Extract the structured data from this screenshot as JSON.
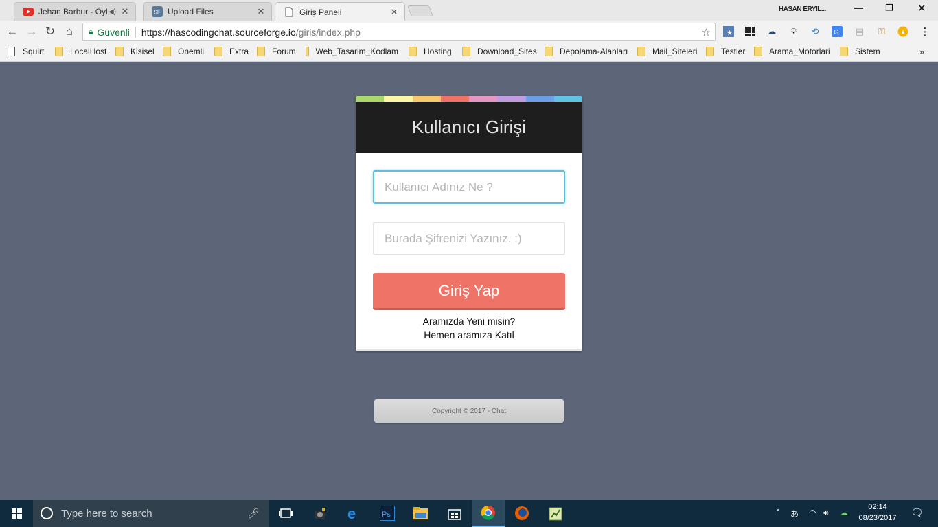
{
  "browser": {
    "tabs": [
      {
        "title": "Jehan Barbur - Öylesin",
        "icon": "youtube-icon",
        "audio": true,
        "active": false
      },
      {
        "title": "Upload Files",
        "icon": "sourceforge-icon",
        "audio": false,
        "active": false
      },
      {
        "title": "Giriş Paneli",
        "icon": "page-icon",
        "audio": false,
        "active": true
      }
    ],
    "profile_name": "HASAN ERYIL...",
    "address": {
      "security_label": "Güvenli",
      "url_host": "https://hascodingchat.sourceforge.io",
      "url_path": "/giris/index.php"
    },
    "bookmarks": [
      {
        "label": "Squirt",
        "type": "page"
      },
      {
        "label": "LocalHost",
        "type": "folder"
      },
      {
        "label": "Kisisel",
        "type": "folder"
      },
      {
        "label": "Onemli",
        "type": "folder"
      },
      {
        "label": "Extra",
        "type": "folder"
      },
      {
        "label": "Forum",
        "type": "folder"
      },
      {
        "label": "Web_Tasarim_Kodlam",
        "type": "folder"
      },
      {
        "label": "Hosting",
        "type": "folder"
      },
      {
        "label": "Download_Sites",
        "type": "folder"
      },
      {
        "label": "Depolama-Alanları",
        "type": "folder"
      },
      {
        "label": "Mail_Siteleri",
        "type": "folder"
      },
      {
        "label": "Testler",
        "type": "folder"
      },
      {
        "label": "Arama_Motorlari",
        "type": "folder"
      },
      {
        "label": "Sistem",
        "type": "folder"
      }
    ],
    "bookmarks_more": "»"
  },
  "page": {
    "stripe_colors": [
      "#a9d86e",
      "#fbf5a5",
      "#f8c96c",
      "#ef7467",
      "#e597c3",
      "#c09be0",
      "#6d9ee6",
      "#62c2e4"
    ],
    "header_title": "Kullanıcı Girişi",
    "username_placeholder": "Kullanıcı Adınız Ne ?",
    "password_placeholder": "Burada Şifrenizi Yazınız. :)",
    "login_button": "Giriş Yap",
    "signup_question": "Aramızda Yeni misin?",
    "signup_link": "Hemen aramıza Katıl",
    "copyright": "Copyright © 2017 - Chat",
    "accent_button_color": "#ef7467",
    "focus_color": "#5bc0de"
  },
  "taskbar": {
    "search_placeholder": "Type here to search",
    "time": "02:14",
    "date": "08/23/2017",
    "ime_label": "あ"
  }
}
